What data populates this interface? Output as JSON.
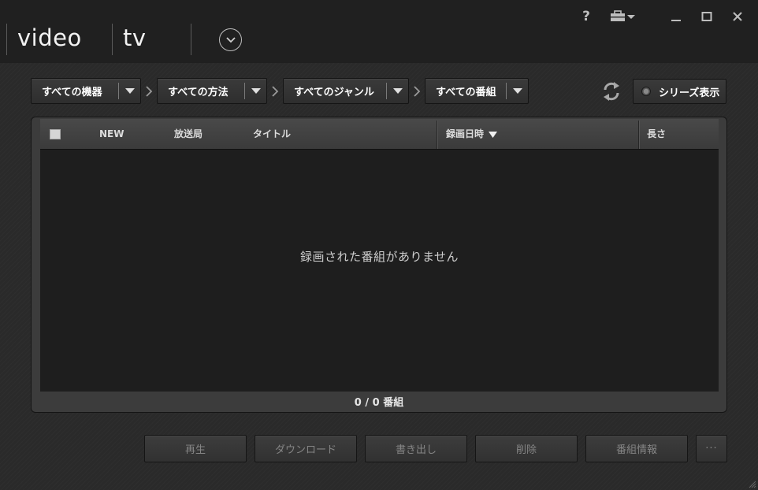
{
  "nav": {
    "tabs": [
      {
        "label": "video"
      },
      {
        "label": "tv"
      }
    ]
  },
  "window_controls": {
    "help_label": "?"
  },
  "filters": [
    {
      "label": "すべての機器"
    },
    {
      "label": "すべての方法"
    },
    {
      "label": "すべてのジャンル"
    },
    {
      "label": "すべての番組"
    }
  ],
  "series_toggle": {
    "label": "シリーズ表示",
    "checked": false
  },
  "table": {
    "columns": [
      {
        "label": ""
      },
      {
        "label": "NEW"
      },
      {
        "label": "放送局"
      },
      {
        "label": "タイトル"
      },
      {
        "label": "録画日時",
        "sorted": "descending"
      },
      {
        "label": "長さ"
      }
    ],
    "empty_message": "録画された番組がありません",
    "count_text": "0 / 0 番組"
  },
  "actions": [
    {
      "label": "再生",
      "enabled": false
    },
    {
      "label": "ダウンロード",
      "enabled": false
    },
    {
      "label": "書き出し",
      "enabled": false
    },
    {
      "label": "削除",
      "enabled": false
    },
    {
      "label": "番組情報",
      "enabled": false
    },
    {
      "label": "···",
      "enabled": false
    }
  ],
  "colors": {
    "background": "#2a2a2a",
    "titlebar": "#202020",
    "list_body": "#1e1e1e",
    "text": "#ffffff",
    "disabled_text": "#858585"
  }
}
